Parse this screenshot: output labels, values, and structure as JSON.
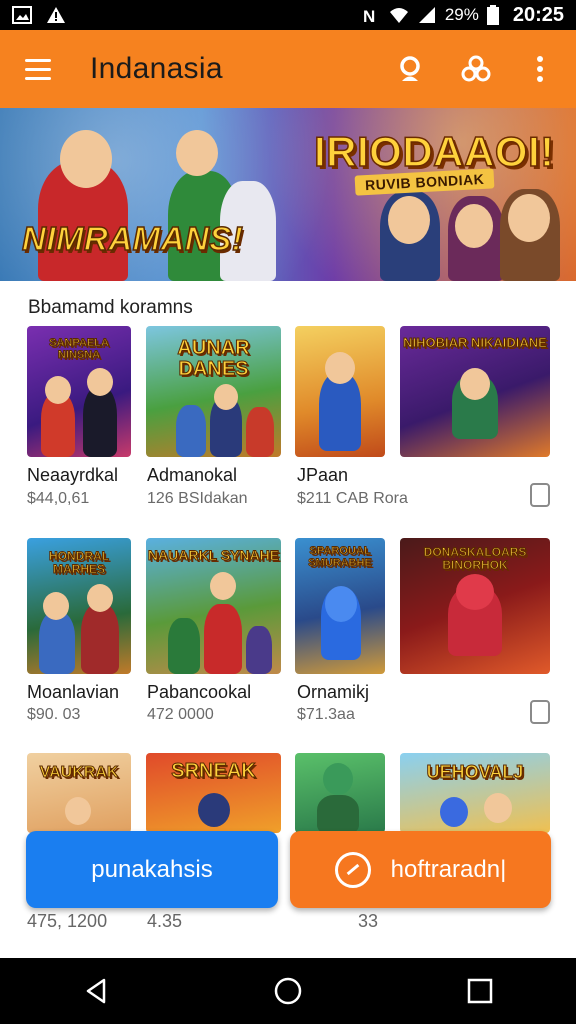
{
  "status_bar": {
    "battery": "29%",
    "time": "20:25",
    "left_icons": [
      "image-icon",
      "alert-icon"
    ],
    "right_icons": [
      "nfc-icon",
      "wifi-icon",
      "signal-icon",
      "battery-icon"
    ]
  },
  "app_bar": {
    "title": "Indanasia",
    "menu_icon": "hamburger-menu-icon",
    "actions": [
      "search-icon",
      "share-icon",
      "more-vert-icon"
    ]
  },
  "banner": {
    "left_text": "NIMRAMANS!",
    "right_title": "IRIODAAOI!",
    "right_subtitle": "RUVIB BONDIAK"
  },
  "section": {
    "title": "Bbamamd koramns"
  },
  "games": [
    {
      "thumb_title": "SANPAELA NINSNA",
      "name": "Neaayrdkal",
      "price": "$44,0,61",
      "checkbox": false
    },
    {
      "thumb_title": "AUNAR DANES",
      "name": "Admanokal",
      "price": "126 BSIdakan",
      "checkbox": false
    },
    {
      "thumb_title": "",
      "name": "JPaan",
      "price": "$211 CAB Rora",
      "checkbox": false
    },
    {
      "thumb_title": "NIHOBIAR NIKAIDIANE",
      "name": "",
      "price": "",
      "checkbox": true
    },
    {
      "thumb_title": "HONDRAL MARHES",
      "name": "Moanlavian",
      "price": "$90. 03",
      "checkbox": false
    },
    {
      "thumb_title": "NAUARKL SYNAHE",
      "name": "Pabancookal",
      "price": "472 0000",
      "checkbox": false
    },
    {
      "thumb_title": "SPAROUAL SMURABHE",
      "name": "Ornamikj",
      "price": "$71.3aa",
      "checkbox": false
    },
    {
      "thumb_title": "DONASKALOARS BINORHOK",
      "name": "",
      "price": "",
      "checkbox": true
    },
    {
      "thumb_title": "VAUKRAK",
      "name": "",
      "price": "",
      "checkbox": false
    },
    {
      "thumb_title": "SRNEAK",
      "name": "",
      "price": "",
      "checkbox": false
    },
    {
      "thumb_title": "",
      "name": "",
      "price": "",
      "checkbox": false
    },
    {
      "thumb_title": "UEHOVALJ",
      "name": "",
      "price": "",
      "checkbox": false
    }
  ],
  "bottom_values": [
    "475, 1200",
    "4.35",
    "33"
  ],
  "buttons": {
    "primary": "punakahsis",
    "secondary": "hoftraradn|"
  },
  "nav_bar": [
    "back-icon",
    "home-icon",
    "recents-icon"
  ],
  "colors": {
    "accent": "#f6821f",
    "primary_button": "#1a7ef0",
    "secondary_button": "#f6771f"
  }
}
